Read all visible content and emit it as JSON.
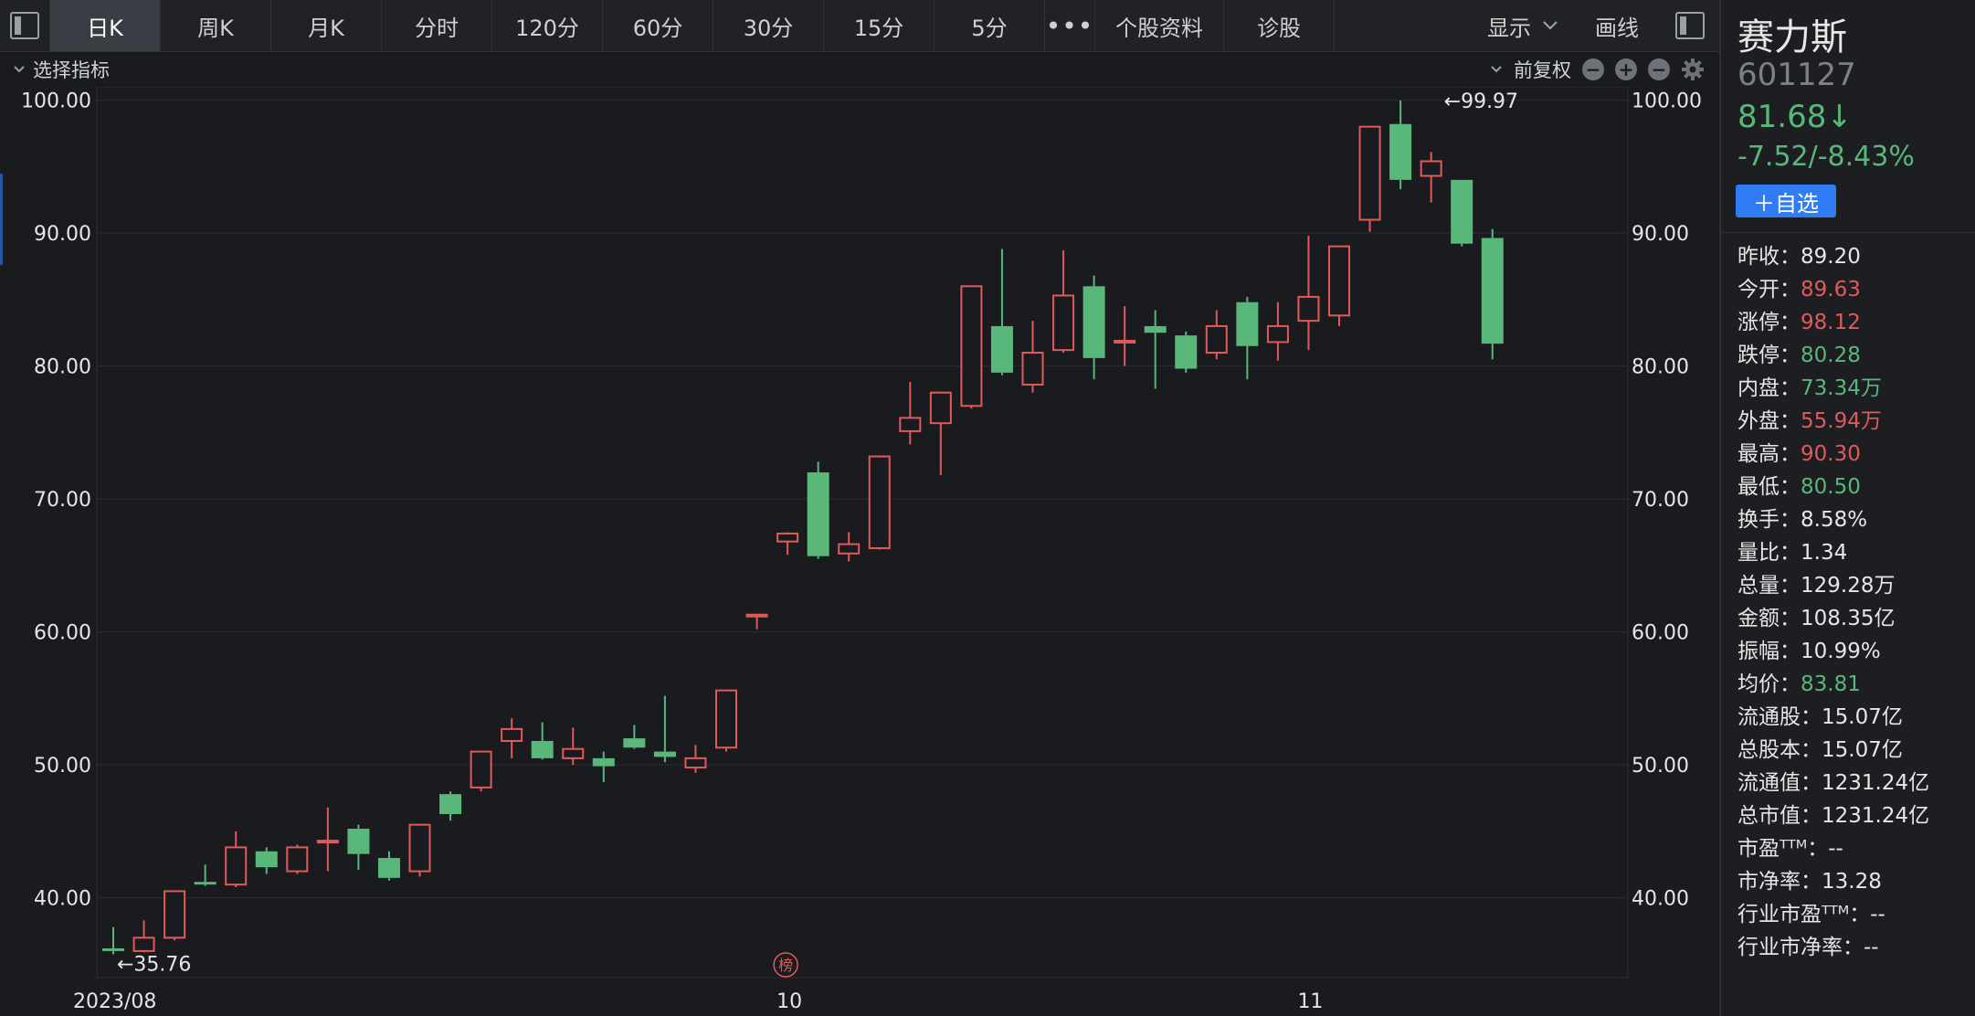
{
  "toolbar": {
    "tabs": [
      "日K",
      "周K",
      "月K",
      "分时",
      "120分",
      "60分",
      "30分",
      "15分",
      "5分",
      "•••",
      "个股资料",
      "诊股"
    ],
    "display_label": "显示",
    "draw_label": "画线"
  },
  "subbar": {
    "indicator_label": "选择指标",
    "adjust_label": "前复权"
  },
  "stock": {
    "name": "赛力斯",
    "code": "601127",
    "price": "81.68↓",
    "change": "-7.52/-8.43%",
    "add_label": "＋自选"
  },
  "colors": {
    "up": "#e15a5a",
    "down": "#5ab77a",
    "accent": "#2f7cf6",
    "background": "#1a1b1f"
  },
  "stats": [
    {
      "label": "昨收：",
      "value": "89.20",
      "color": "white"
    },
    {
      "label": "今开：",
      "value": "89.63",
      "color": "red"
    },
    {
      "label": "涨停：",
      "value": "98.12",
      "color": "red"
    },
    {
      "label": "跌停：",
      "value": "80.28",
      "color": "green"
    },
    {
      "label": "内盘：",
      "value": "73.34万",
      "color": "green"
    },
    {
      "label": "外盘：",
      "value": "55.94万",
      "color": "red"
    },
    {
      "label": "最高：",
      "value": "90.30",
      "color": "red"
    },
    {
      "label": "最低：",
      "value": "80.50",
      "color": "green"
    },
    {
      "label": "换手：",
      "value": "8.58%",
      "color": "white"
    },
    {
      "label": "量比：",
      "value": "1.34",
      "color": "white"
    },
    {
      "label": "总量：",
      "value": "129.28万",
      "color": "white"
    },
    {
      "label": "金额：",
      "value": "108.35亿",
      "color": "white"
    },
    {
      "label": "振幅：",
      "value": "10.99%",
      "color": "white"
    },
    {
      "label": "均价：",
      "value": "83.81",
      "color": "green"
    },
    {
      "label": "流通股：",
      "value": "15.07亿",
      "color": "white"
    },
    {
      "label": "总股本：",
      "value": "15.07亿",
      "color": "white"
    },
    {
      "label": "流通值：",
      "value": "1231.24亿",
      "color": "white"
    },
    {
      "label": "总市值：",
      "value": "1231.24亿",
      "color": "white"
    },
    {
      "label": "市盈ᵀᵀᴹ：",
      "value": "--",
      "color": "white"
    },
    {
      "label": "市净率：",
      "value": "13.28",
      "color": "white"
    },
    {
      "label": "行业市盈ᵀᵀᴹ：",
      "value": "--",
      "color": "white"
    },
    {
      "label": "行业市净率：",
      "value": "--",
      "color": "white"
    }
  ],
  "chart_data": {
    "type": "candlestick",
    "y_ticks": [
      "100.00",
      "90.00",
      "80.00",
      "70.00",
      "60.00",
      "50.00",
      "40.00"
    ],
    "y_tick_values": [
      100,
      90,
      80,
      70,
      60,
      50,
      40
    ],
    "ylim": [
      34,
      101
    ],
    "x_labels": [
      {
        "index": 0,
        "text": "2023/08"
      },
      {
        "index": 22,
        "text": "10"
      },
      {
        "index": 39,
        "text": "11"
      }
    ],
    "max_label": {
      "index": 43,
      "value": 99.97,
      "text": "←99.97"
    },
    "min_label": {
      "index": 0,
      "value": 35.76,
      "text": "←35.76"
    },
    "badge_text": "榜",
    "badge_index": 22,
    "candles": [
      {
        "o": 36.2,
        "h": 37.8,
        "l": 35.76,
        "c": 36.0
      },
      {
        "o": 36.0,
        "h": 38.3,
        "l": 35.9,
        "c": 37.0
      },
      {
        "o": 37.0,
        "h": 40.5,
        "l": 36.8,
        "c": 40.5
      },
      {
        "o": 41.2,
        "h": 42.5,
        "l": 40.9,
        "c": 41.0
      },
      {
        "o": 41.0,
        "h": 45.0,
        "l": 40.8,
        "c": 43.8
      },
      {
        "o": 43.5,
        "h": 43.8,
        "l": 41.8,
        "c": 42.3
      },
      {
        "o": 42.0,
        "h": 44.0,
        "l": 41.8,
        "c": 43.8
      },
      {
        "o": 44.3,
        "h": 46.8,
        "l": 42.0,
        "c": 44.3
      },
      {
        "o": 45.2,
        "h": 45.5,
        "l": 42.1,
        "c": 43.3
      },
      {
        "o": 43.0,
        "h": 43.5,
        "l": 41.3,
        "c": 41.5
      },
      {
        "o": 42.0,
        "h": 45.5,
        "l": 41.6,
        "c": 45.5
      },
      {
        "o": 47.8,
        "h": 48.0,
        "l": 45.8,
        "c": 46.3
      },
      {
        "o": 48.3,
        "h": 51.0,
        "l": 48.0,
        "c": 51.0
      },
      {
        "o": 51.8,
        "h": 53.5,
        "l": 50.5,
        "c": 52.7
      },
      {
        "o": 51.8,
        "h": 53.2,
        "l": 50.4,
        "c": 50.5
      },
      {
        "o": 50.5,
        "h": 52.8,
        "l": 50.0,
        "c": 51.2
      },
      {
        "o": 50.5,
        "h": 51.0,
        "l": 48.7,
        "c": 49.9
      },
      {
        "o": 52.0,
        "h": 53.0,
        "l": 51.2,
        "c": 51.3
      },
      {
        "o": 51.0,
        "h": 55.2,
        "l": 50.2,
        "c": 50.6
      },
      {
        "o": 49.8,
        "h": 51.5,
        "l": 49.4,
        "c": 50.5
      },
      {
        "o": 51.3,
        "h": 55.6,
        "l": 51.0,
        "c": 55.6
      },
      {
        "o": 61.2,
        "h": 61.3,
        "l": 60.2,
        "c": 61.3
      },
      {
        "o": 66.8,
        "h": 67.5,
        "l": 65.8,
        "c": 67.4
      },
      {
        "o": 72.0,
        "h": 72.8,
        "l": 65.5,
        "c": 65.7
      },
      {
        "o": 65.9,
        "h": 67.5,
        "l": 65.3,
        "c": 66.6
      },
      {
        "o": 66.3,
        "h": 73.2,
        "l": 66.2,
        "c": 73.2
      },
      {
        "o": 75.1,
        "h": 78.8,
        "l": 74.1,
        "c": 76.1
      },
      {
        "o": 75.7,
        "h": 78.0,
        "l": 71.8,
        "c": 78.0
      },
      {
        "o": 77.0,
        "h": 86.0,
        "l": 76.8,
        "c": 86.0
      },
      {
        "o": 83.0,
        "h": 88.8,
        "l": 79.3,
        "c": 79.5
      },
      {
        "o": 78.6,
        "h": 83.4,
        "l": 78.0,
        "c": 81.0
      },
      {
        "o": 81.2,
        "h": 88.7,
        "l": 81.0,
        "c": 85.3
      },
      {
        "o": 86.0,
        "h": 86.8,
        "l": 79.0,
        "c": 80.6
      },
      {
        "o": 81.8,
        "h": 84.5,
        "l": 80.0,
        "c": 81.9
      },
      {
        "o": 83.0,
        "h": 84.2,
        "l": 78.3,
        "c": 82.5
      },
      {
        "o": 82.3,
        "h": 82.6,
        "l": 79.5,
        "c": 79.8
      },
      {
        "o": 81.0,
        "h": 84.2,
        "l": 80.5,
        "c": 83.0
      },
      {
        "o": 84.8,
        "h": 85.2,
        "l": 79.0,
        "c": 81.5
      },
      {
        "o": 81.8,
        "h": 84.8,
        "l": 80.4,
        "c": 83.0
      },
      {
        "o": 83.4,
        "h": 89.8,
        "l": 81.2,
        "c": 85.2
      },
      {
        "o": 83.8,
        "h": 89.0,
        "l": 83.0,
        "c": 89.0
      },
      {
        "o": 91.0,
        "h": 98.0,
        "l": 90.1,
        "c": 98.0
      },
      {
        "o": 98.2,
        "h": 99.97,
        "l": 93.3,
        "c": 94.0
      },
      {
        "o": 94.3,
        "h": 96.1,
        "l": 92.3,
        "c": 95.4
      },
      {
        "o": 94.0,
        "h": 94.0,
        "l": 89.0,
        "c": 89.2
      },
      {
        "o": 89.63,
        "h": 90.3,
        "l": 80.5,
        "c": 81.68
      }
    ]
  }
}
